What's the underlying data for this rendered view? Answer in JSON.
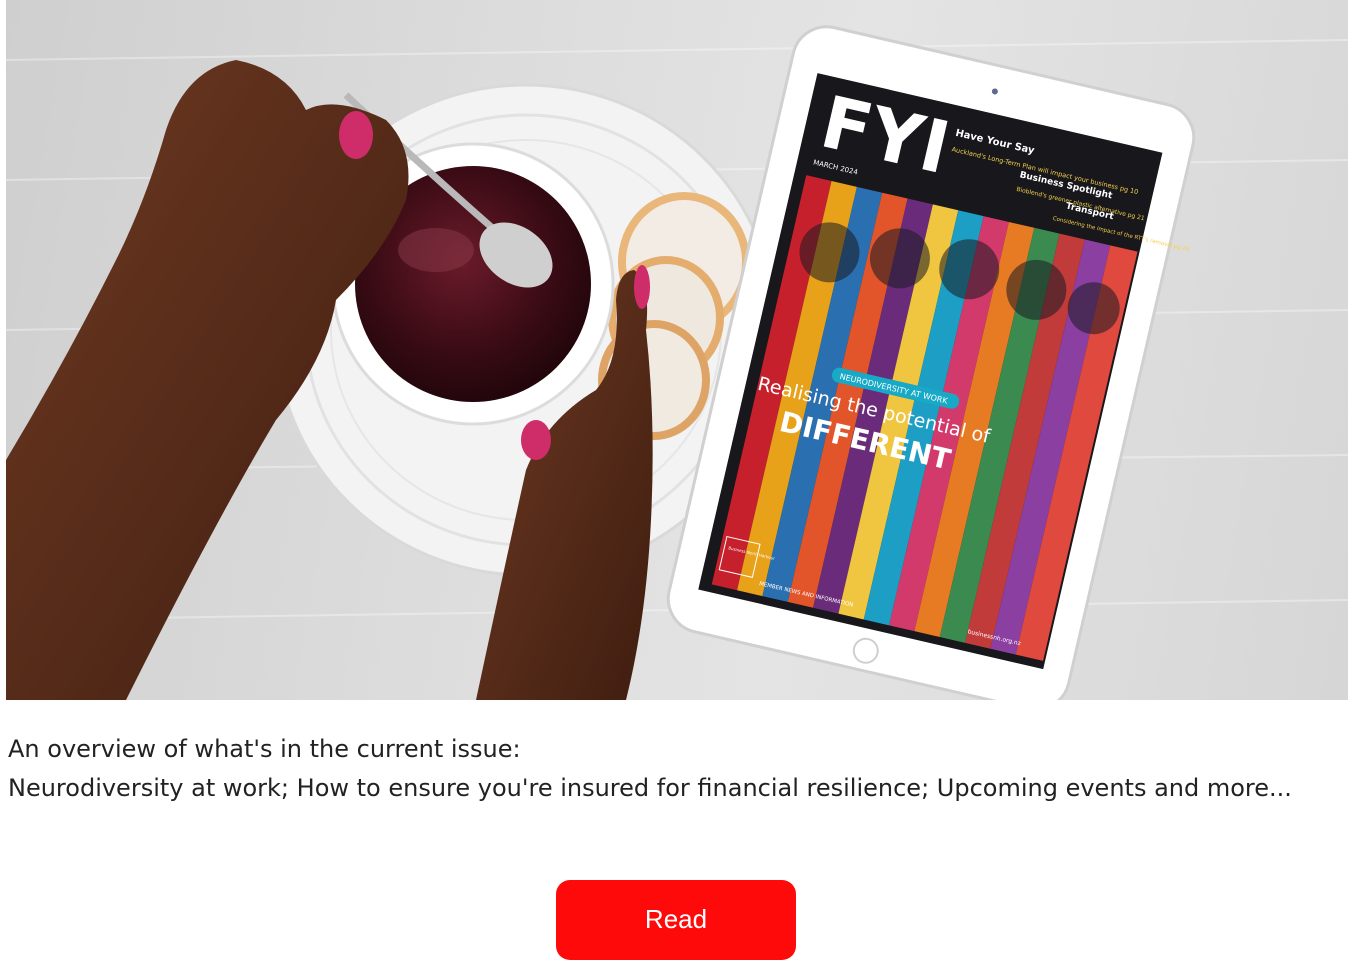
{
  "hero": {
    "magazine": {
      "masthead": "FYI",
      "date": "MARCH 2024",
      "teasers": [
        {
          "heading": "Have Your Say",
          "body": "Auckland's Long-Term Plan will impact your business pg 10"
        },
        {
          "heading": "Business Spotlight",
          "body": "Bioblend's greener plastic alternative pg 21"
        },
        {
          "heading": "Transport",
          "body": "Considering the impact of the RTT's removal pg 28"
        }
      ],
      "tag": "NEURODIVERSITY AT WORK",
      "headline_line1": "Realising the potential of",
      "headline_line2": "DIFFERENT",
      "publisher": "Business North Harbour",
      "footer_left": "MEMBER NEWS AND INFORMATION",
      "footer_right": "businessnh.org.nz"
    }
  },
  "overview": {
    "heading": "An overview of what's in the current issue:",
    "description": "Neurodiversity at work; How to ensure you're insured for financial resilience; Upcoming events and more..."
  },
  "cta": {
    "read_label": "Read"
  },
  "colors": {
    "button": "#ff0a0a",
    "tag": "#17a9c6"
  }
}
